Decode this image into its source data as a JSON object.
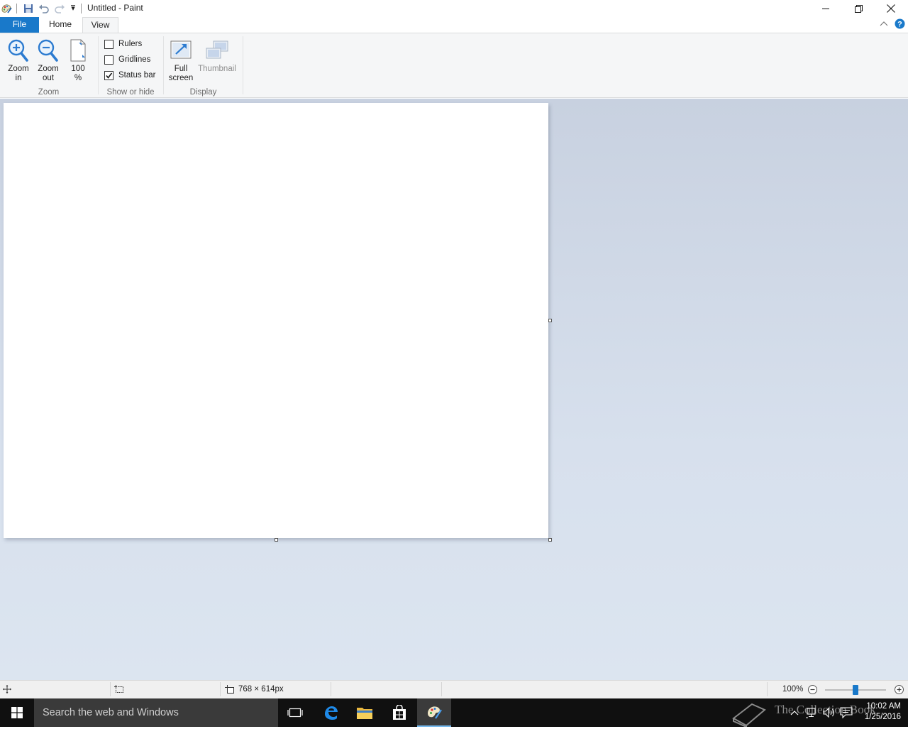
{
  "window": {
    "title": "Untitled - Paint",
    "qat_dropdown_glyph": "▾"
  },
  "tabs": [
    {
      "label": "File"
    },
    {
      "label": "Home"
    },
    {
      "label": "View"
    }
  ],
  "ribbon": {
    "zoom_group": {
      "label": "Zoom",
      "zoom_in": {
        "line1": "Zoom",
        "line2": "in"
      },
      "zoom_out": {
        "line1": "Zoom",
        "line2": "out"
      },
      "actual": {
        "line1": "100",
        "line2": "%"
      }
    },
    "show_hide_group": {
      "label": "Show or hide",
      "rulers": {
        "label": "Rulers",
        "checked": false
      },
      "gridlines": {
        "label": "Gridlines",
        "checked": false
      },
      "status_bar": {
        "label": "Status bar",
        "checked": true
      }
    },
    "display_group": {
      "label": "Display",
      "full_screen": {
        "line1": "Full",
        "line2": "screen"
      },
      "thumbnail": {
        "label": "Thumbnail"
      }
    }
  },
  "status": {
    "image_size": "768 × 614px",
    "zoom_level": "100%",
    "zoom_fraction": 0.5
  },
  "taskbar": {
    "search_placeholder": "Search the web and Windows",
    "time": "10:02 AM",
    "date": "1/25/2016",
    "watermark": "The Collection Book"
  },
  "colors": {
    "accent": "#1979ca",
    "workspace": "#d3dcea",
    "help": "#1979ca"
  }
}
